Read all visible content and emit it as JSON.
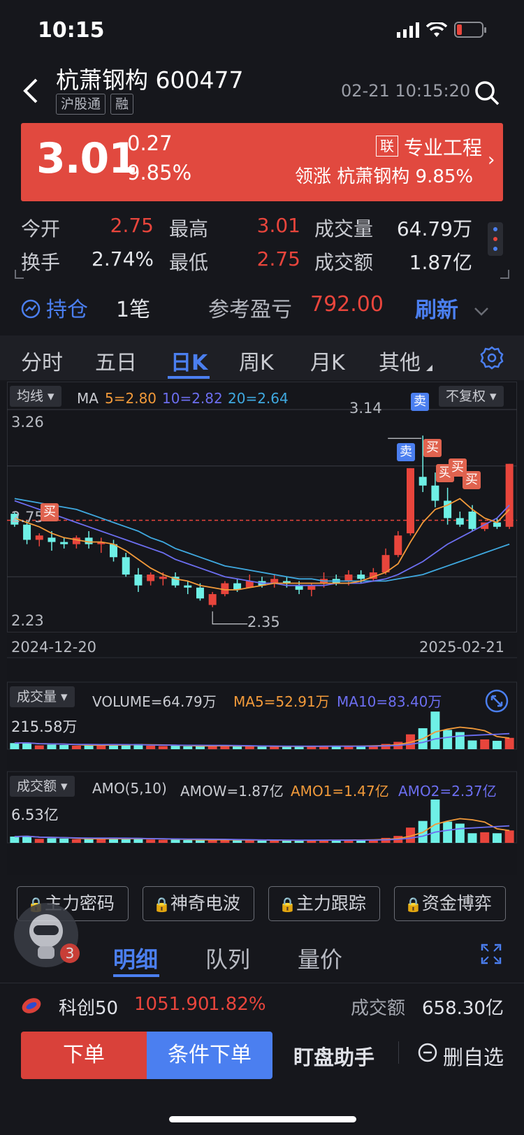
{
  "status": {
    "time": "10:15"
  },
  "header": {
    "title": "杭萧钢构 600477",
    "tags": [
      "沪股通",
      "融"
    ],
    "datetime": "02-21 10:15:20"
  },
  "quote": {
    "price": "3.01",
    "change": "0.27",
    "change_pct": "9.85%",
    "sector_badge": "联",
    "sector": "专业工程",
    "leader_text": "领涨 杭萧钢构 9.85%"
  },
  "stats": {
    "open_label": "今开",
    "open": "2.75",
    "high_label": "最高",
    "high": "3.01",
    "vol_label": "成交量",
    "vol": "64.79万",
    "turnover_label": "换手",
    "turnover": "2.74%",
    "low_label": "最低",
    "low": "2.75",
    "amount_label": "成交额",
    "amount": "1.87亿"
  },
  "position": {
    "label": "持仓",
    "count": "1笔",
    "pnl_label": "参考盈亏",
    "pnl": "792.00",
    "refresh": "刷新"
  },
  "tabs": [
    "分时",
    "五日",
    "日K",
    "周K",
    "月K",
    "其他"
  ],
  "chart_controls": {
    "ma_dropdown": "均线",
    "ma_label": "MA",
    "ma5": "5=2.80",
    "ma10": "10=2.82",
    "ma20": "20=2.64",
    "adjust": "不复权",
    "y_top": "3.26",
    "y_mid": "2.75",
    "y_bottom": "2.23",
    "high_mark": "3.14",
    "low_mark": "2.35",
    "date_start": "2024-12-20",
    "date_end": "2025-02-21",
    "buy": "买",
    "sell": "卖",
    "vol_dropdown": "成交量",
    "vol_text": "VOLUME=64.79万",
    "vol_ma5": "MA5=52.91万",
    "vol_ma10": "MA10=83.40万",
    "vol_max": "215.58万",
    "amo_dropdown": "成交额",
    "amo_title": "AMO(5,10)",
    "amow": "AMOW=1.87亿",
    "amo1": "AMO1=1.47亿",
    "amo2": "AMO2=2.37亿",
    "amo_max": "6.53亿"
  },
  "colors": {
    "up": "#e8453c",
    "down": "#6ef0e6",
    "ma5": "#f29a3a",
    "ma10": "#6c6ef0",
    "ma20": "#3fa9e0",
    "accent": "#4b7ff0"
  },
  "chart_data": {
    "type": "candlestick",
    "x_range": [
      "2024-12-20",
      "2025-02-21"
    ],
    "ylim": [
      2.23,
      3.26
    ],
    "ohlc": [
      [
        2.78,
        2.79,
        2.72,
        2.73
      ],
      [
        2.73,
        2.75,
        2.64,
        2.66
      ],
      [
        2.66,
        2.69,
        2.63,
        2.68
      ],
      [
        2.67,
        2.7,
        2.61,
        2.65
      ],
      [
        2.65,
        2.67,
        2.62,
        2.64
      ],
      [
        2.64,
        2.68,
        2.62,
        2.67
      ],
      [
        2.67,
        2.7,
        2.62,
        2.64
      ],
      [
        2.64,
        2.67,
        2.6,
        2.65
      ],
      [
        2.64,
        2.66,
        2.56,
        2.58
      ],
      [
        2.58,
        2.6,
        2.49,
        2.5
      ],
      [
        2.5,
        2.53,
        2.42,
        2.45
      ],
      [
        2.47,
        2.51,
        2.45,
        2.5
      ],
      [
        2.48,
        2.51,
        2.45,
        2.49
      ],
      [
        2.49,
        2.51,
        2.44,
        2.45
      ],
      [
        2.45,
        2.47,
        2.41,
        2.44
      ],
      [
        2.44,
        2.46,
        2.38,
        2.39
      ],
      [
        2.36,
        2.42,
        2.35,
        2.41
      ],
      [
        2.41,
        2.47,
        2.4,
        2.46
      ],
      [
        2.46,
        2.48,
        2.42,
        2.43
      ],
      [
        2.44,
        2.5,
        2.44,
        2.47
      ],
      [
        2.47,
        2.49,
        2.44,
        2.45
      ],
      [
        2.46,
        2.5,
        2.44,
        2.48
      ],
      [
        2.47,
        2.49,
        2.44,
        2.46
      ],
      [
        2.45,
        2.47,
        2.41,
        2.43
      ],
      [
        2.43,
        2.46,
        2.4,
        2.45
      ],
      [
        2.46,
        2.51,
        2.44,
        2.48
      ],
      [
        2.48,
        2.5,
        2.45,
        2.46
      ],
      [
        2.47,
        2.52,
        2.45,
        2.5
      ],
      [
        2.5,
        2.52,
        2.46,
        2.48
      ],
      [
        2.48,
        2.53,
        2.47,
        2.51
      ],
      [
        2.51,
        2.62,
        2.5,
        2.59
      ],
      [
        2.59,
        2.7,
        2.58,
        2.68
      ],
      [
        2.69,
        2.99,
        2.68,
        2.99
      ],
      [
        2.95,
        3.14,
        2.88,
        2.91
      ],
      [
        2.91,
        2.97,
        2.81,
        2.84
      ],
      [
        2.84,
        2.9,
        2.73,
        2.76
      ],
      [
        2.76,
        2.79,
        2.72,
        2.73
      ],
      [
        2.79,
        2.82,
        2.7,
        2.71
      ],
      [
        2.71,
        2.74,
        2.7,
        2.74
      ],
      [
        2.74,
        2.76,
        2.71,
        2.72
      ],
      [
        2.72,
        3.01,
        2.71,
        3.01
      ]
    ],
    "ma5": [
      2.76,
      2.74,
      2.72,
      2.69,
      2.67,
      2.66,
      2.65,
      2.65,
      2.64,
      2.61,
      2.57,
      2.53,
      2.5,
      2.48,
      2.47,
      2.45,
      2.44,
      2.43,
      2.43,
      2.44,
      2.45,
      2.46,
      2.46,
      2.46,
      2.46,
      2.46,
      2.46,
      2.46,
      2.47,
      2.49,
      2.51,
      2.55,
      2.65,
      2.74,
      2.8,
      2.82,
      2.85,
      2.8,
      2.76,
      2.74,
      2.8
    ],
    "ma10": [
      2.84,
      2.82,
      2.8,
      2.78,
      2.76,
      2.74,
      2.72,
      2.7,
      2.68,
      2.66,
      2.64,
      2.62,
      2.6,
      2.57,
      2.55,
      2.53,
      2.51,
      2.49,
      2.48,
      2.47,
      2.46,
      2.46,
      2.45,
      2.45,
      2.45,
      2.45,
      2.46,
      2.46,
      2.46,
      2.47,
      2.48,
      2.5,
      2.53,
      2.56,
      2.6,
      2.64,
      2.67,
      2.7,
      2.73,
      2.76,
      2.82
    ],
    "ma20": [
      2.85,
      2.84,
      2.83,
      2.82,
      2.81,
      2.8,
      2.78,
      2.76,
      2.74,
      2.72,
      2.7,
      2.67,
      2.65,
      2.62,
      2.6,
      2.58,
      2.56,
      2.54,
      2.53,
      2.52,
      2.51,
      2.5,
      2.49,
      2.48,
      2.48,
      2.47,
      2.47,
      2.47,
      2.47,
      2.47,
      2.47,
      2.48,
      2.49,
      2.5,
      2.52,
      2.54,
      2.56,
      2.58,
      2.6,
      2.62,
      2.64
    ],
    "volume": [
      35,
      38,
      22,
      26,
      24,
      20,
      24,
      22,
      28,
      25,
      30,
      20,
      18,
      20,
      17,
      18,
      22,
      20,
      16,
      17,
      15,
      16,
      15,
      18,
      16,
      18,
      20,
      17,
      19,
      22,
      30,
      42,
      85,
      120,
      215,
      110,
      98,
      50,
      56,
      48,
      64.79
    ],
    "amount": [
      0.95,
      1.05,
      0.6,
      0.7,
      0.65,
      0.55,
      0.62,
      0.6,
      0.72,
      0.62,
      0.72,
      0.5,
      0.45,
      0.48,
      0.42,
      0.43,
      0.5,
      0.48,
      0.38,
      0.4,
      0.36,
      0.38,
      0.36,
      0.42,
      0.38,
      0.43,
      0.48,
      0.42,
      0.46,
      0.52,
      0.75,
      1.05,
      2.3,
      3.3,
      6.53,
      3.2,
      2.9,
      1.45,
      1.6,
      1.45,
      1.87
    ]
  },
  "tools": [
    "主力密码",
    "神奇电波",
    "主力跟踪",
    "资金博弈"
  ],
  "bottom_tabs": [
    "明细",
    "队列",
    "量价"
  ],
  "assistant_badge": "3",
  "index": {
    "name": "科创50",
    "value": "1051.90",
    "pct": "1.82%",
    "amount_label": "成交额",
    "amount": "658.30亿"
  },
  "actions": {
    "order": "下单",
    "conditional": "条件下单",
    "assistant": "盯盘助手",
    "remove": "删自选"
  }
}
